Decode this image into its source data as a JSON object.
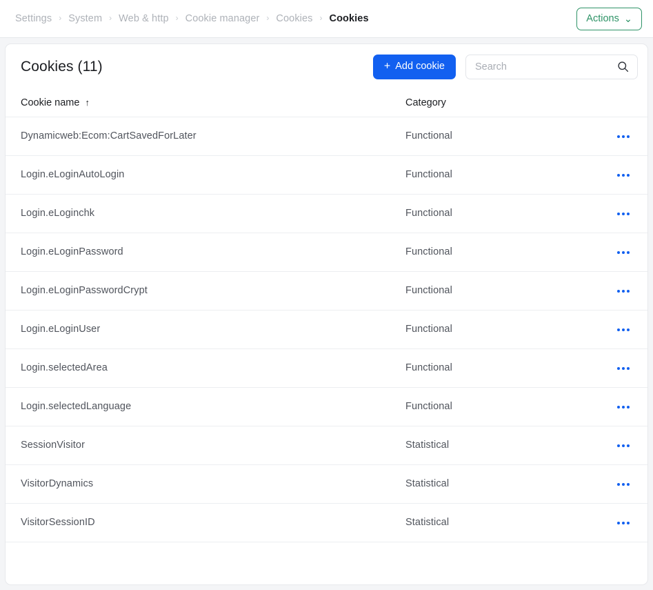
{
  "breadcrumb": {
    "separator": "›",
    "items": [
      {
        "label": "Settings",
        "current": false
      },
      {
        "label": "System",
        "current": false
      },
      {
        "label": "Web & http",
        "current": false
      },
      {
        "label": "Cookie manager",
        "current": false
      },
      {
        "label": "Cookies",
        "current": false
      },
      {
        "label": "Cookies",
        "current": true
      }
    ]
  },
  "topbar": {
    "actions_label": "Actions",
    "actions_chevron": "⌄",
    "actions_color": "#2e9367"
  },
  "card": {
    "title": "Cookies (11)",
    "add_button": {
      "label": "Add cookie",
      "plus": "+",
      "color": "#1260f0"
    },
    "search": {
      "value": "",
      "placeholder": "Search",
      "icon": "search-icon"
    },
    "table": {
      "columns": [
        {
          "key": "name",
          "label": "Cookie name",
          "sort": "asc",
          "sort_glyph": "↑"
        },
        {
          "key": "category",
          "label": "Category",
          "sort": null,
          "sort_glyph": ""
        }
      ],
      "row_menu_icon": "ellipsis-horizontal-icon",
      "rows": [
        {
          "name": "Dynamicweb:Ecom:CartSavedForLater",
          "category": "Functional"
        },
        {
          "name": "Login.eLoginAutoLogin",
          "category": "Functional"
        },
        {
          "name": "Login.eLoginchk",
          "category": "Functional"
        },
        {
          "name": "Login.eLoginPassword",
          "category": "Functional"
        },
        {
          "name": "Login.eLoginPasswordCrypt",
          "category": "Functional"
        },
        {
          "name": "Login.eLoginUser",
          "category": "Functional"
        },
        {
          "name": "Login.selectedArea",
          "category": "Functional"
        },
        {
          "name": "Login.selectedLanguage",
          "category": "Functional"
        },
        {
          "name": "SessionVisitor",
          "category": "Statistical"
        },
        {
          "name": "VisitorDynamics",
          "category": "Statistical"
        },
        {
          "name": "VisitorSessionID",
          "category": "Statistical"
        }
      ]
    }
  }
}
